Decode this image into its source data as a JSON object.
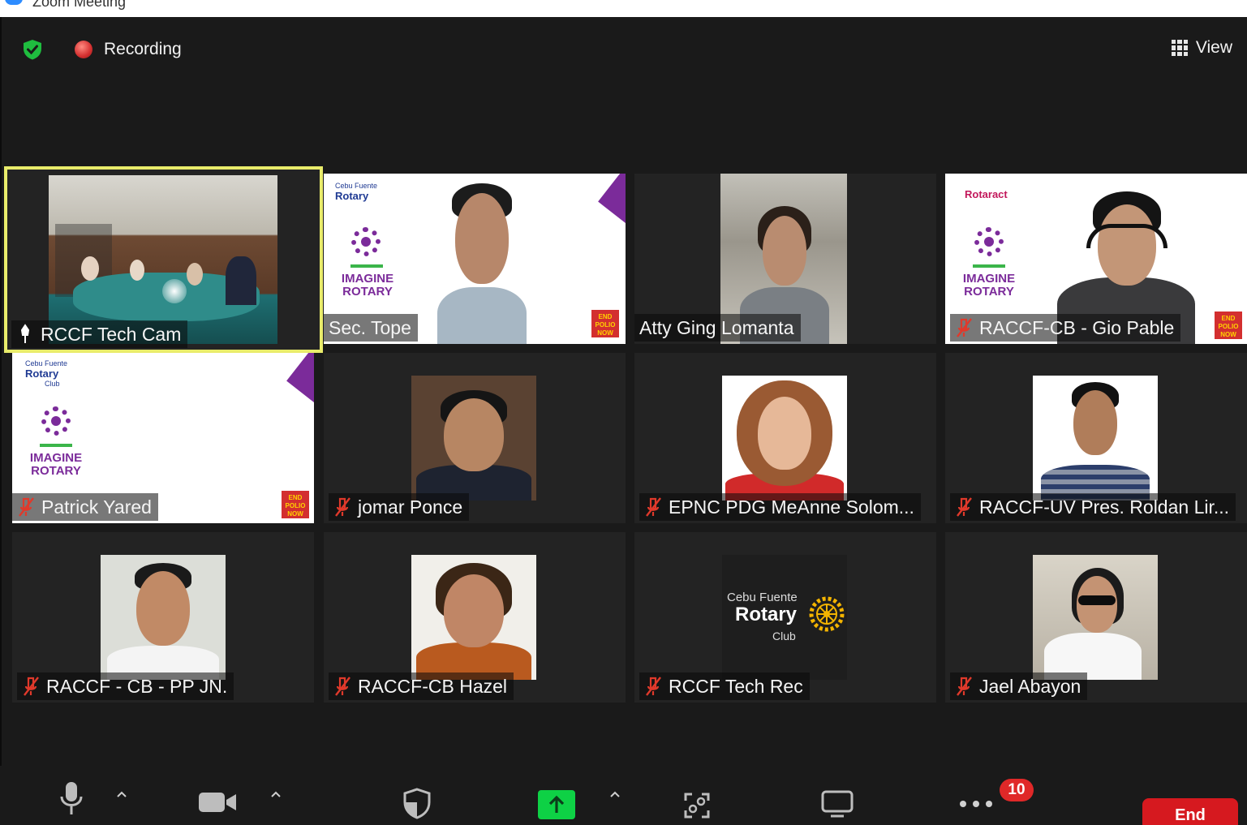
{
  "window": {
    "title": "Zoom Meeting"
  },
  "top_bar": {
    "recording_label": "Recording",
    "view_label": "View"
  },
  "participants": [
    {
      "name": "RCCF Tech Cam",
      "video": "room",
      "active": true,
      "mic": "spotlight"
    },
    {
      "name": "Sec. Tope",
      "video": "slide-person",
      "mic": "none"
    },
    {
      "name": "Atty Ging Lomanta",
      "video": "person",
      "mic": "none"
    },
    {
      "name": "RACCF-CB - Gio Pable",
      "video": "slide-person",
      "mic": "muted"
    },
    {
      "name": "Patrick Yared",
      "video": "slide",
      "mic": "muted"
    },
    {
      "name": "jomar Ponce",
      "video": "photo",
      "mic": "muted"
    },
    {
      "name": "EPNC PDG MeAnne Solom...",
      "video": "photo",
      "mic": "muted"
    },
    {
      "name": "RACCF-UV Pres. Roldan Lir...",
      "video": "photo",
      "mic": "muted"
    },
    {
      "name": "RACCF - CB - PP JN.",
      "video": "photo",
      "mic": "muted"
    },
    {
      "name": "RACCF-CB Hazel",
      "video": "photo",
      "mic": "muted"
    },
    {
      "name": "RCCF Tech Rec",
      "video": "logo",
      "mic": "muted"
    },
    {
      "name": "Jael Abayon",
      "video": "photo",
      "mic": "muted"
    }
  ],
  "slides": {
    "club_small": "Cebu Fuente",
    "club_name": "Rotary",
    "club_suffix": "Club",
    "rotaract": "Rotaract",
    "imagine": "IMAGINE",
    "rotary": "ROTARY",
    "endpolio": "END POLIO NOW"
  },
  "logo_tile": {
    "small": "Cebu Fuente",
    "big": "Rotary",
    "suffix": "Club"
  },
  "toolbar": {
    "more_badge": "10",
    "end_label": "End"
  },
  "colors": {
    "accent_green": "#0ed145",
    "active_outline": "#e9ec6b",
    "end_red": "#d6191f",
    "rotary_purple": "#7b2b9a"
  }
}
